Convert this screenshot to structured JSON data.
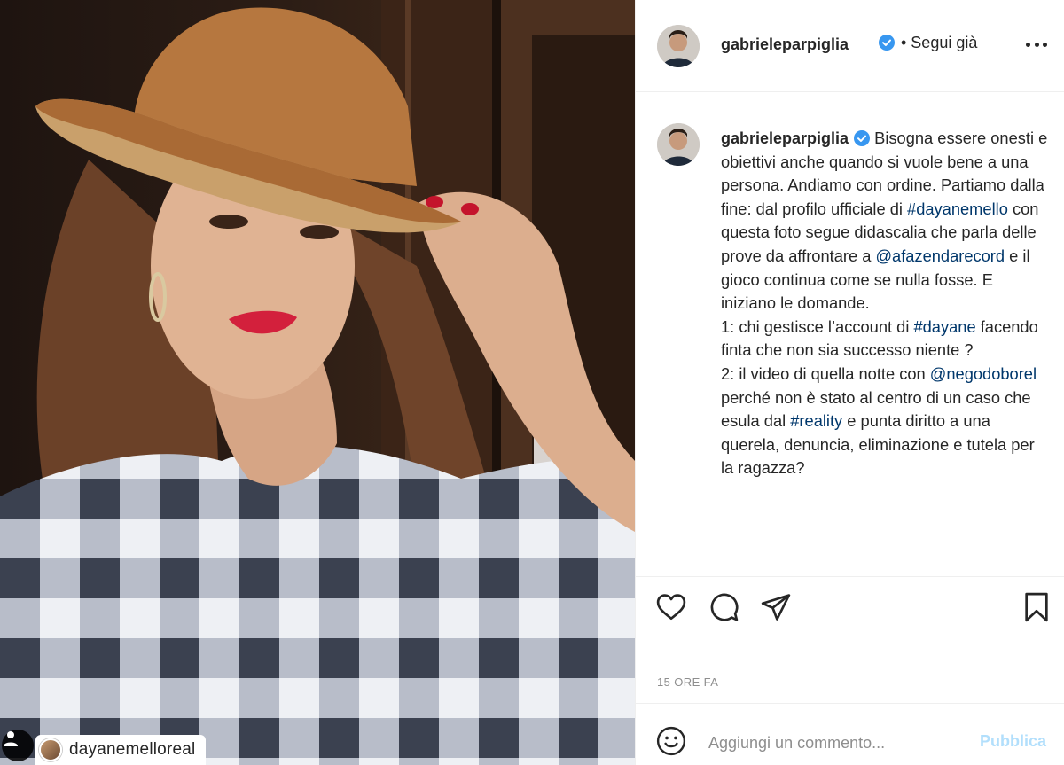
{
  "photo": {
    "tagged_user": "dayanemelloreal"
  },
  "header": {
    "username": "gabrieleparpiglia",
    "follow_status": "• Segui già"
  },
  "caption": {
    "username": "gabrieleparpiglia",
    "segments": [
      {
        "text": "Bisogna essere onesti e obiettivi anche quando si vuole bene a una persona. Andiamo con ordine. Partiamo dalla fine: dal profilo ufficiale di "
      },
      {
        "text": "#dayanemello",
        "link": true
      },
      {
        "text": " con questa foto segue didascalia che parla delle prove da affrontare a "
      },
      {
        "text": "@afazendarecord",
        "link": true
      },
      {
        "text": " e il gioco continua come se nulla fosse. E iniziano le domande."
      },
      {
        "text": "\n1: chi gestisce l’account di "
      },
      {
        "text": "#dayane",
        "link": true
      },
      {
        "text": " facendo finta che non sia successo niente ?\n2: il video di quella notte con "
      },
      {
        "text": "@negodoborel",
        "link": true
      },
      {
        "text": " perché non è stato al centro di un caso che esula dal "
      },
      {
        "text": "#reality",
        "link": true
      },
      {
        "text": " e punta diritto a una querela, denuncia, eliminazione e tutela per la ragazza?"
      }
    ]
  },
  "actions": {
    "icons": [
      "heart-icon",
      "comment-icon",
      "share-icon",
      "bookmark-icon"
    ]
  },
  "timestamp": "15 ORE FA",
  "comment_box": {
    "placeholder": "Aggiungi un commento...",
    "post_label": "Pubblica"
  },
  "colors": {
    "link": "#00376b",
    "verified": "#3897f0",
    "post_disabled": "#b2dffc",
    "muted": "#8e8e8e"
  }
}
